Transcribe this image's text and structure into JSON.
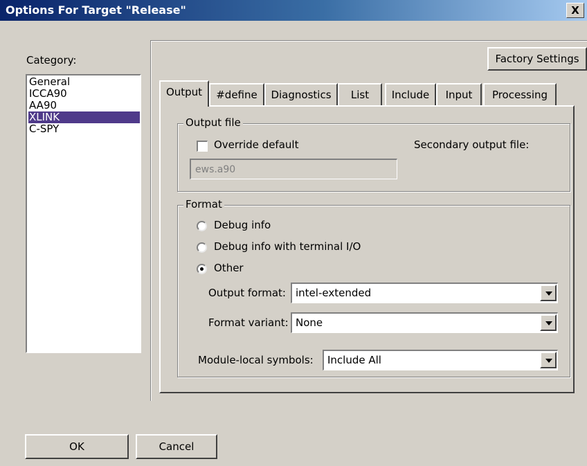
{
  "window": {
    "title": "Options For Target \"Release\"",
    "close_label": "X"
  },
  "category": {
    "label": "Category:",
    "items": [
      {
        "label": "General"
      },
      {
        "label": "ICCA90"
      },
      {
        "label": "AA90"
      },
      {
        "label": "XLINK",
        "selected": true
      },
      {
        "label": "C-SPY"
      }
    ]
  },
  "factory_button": "Factory Settings",
  "tabs": [
    {
      "label": "Output",
      "active": true
    },
    {
      "label": "#define"
    },
    {
      "label": "Diagnostics"
    },
    {
      "label": "List"
    },
    {
      "label": "Include"
    },
    {
      "label": "Input"
    },
    {
      "label": "Processing"
    }
  ],
  "output_file": {
    "legend": "Output file",
    "override_label": "Override default",
    "override_checked": false,
    "secondary_label": "Secondary output file:",
    "filename_value": "ews.a90"
  },
  "format": {
    "legend": "Format",
    "options": [
      {
        "label": "Debug info",
        "checked": false
      },
      {
        "label": "Debug info with terminal I/O",
        "checked": false
      },
      {
        "label": "Other",
        "checked": true
      }
    ],
    "output_format_label": "Output format:",
    "output_format_value": "intel-extended",
    "format_variant_label": "Format variant:",
    "format_variant_value": "None",
    "module_local_label": "Module-local symbols:",
    "module_local_value": "Include All"
  },
  "buttons": {
    "ok": "OK",
    "cancel": "Cancel"
  }
}
